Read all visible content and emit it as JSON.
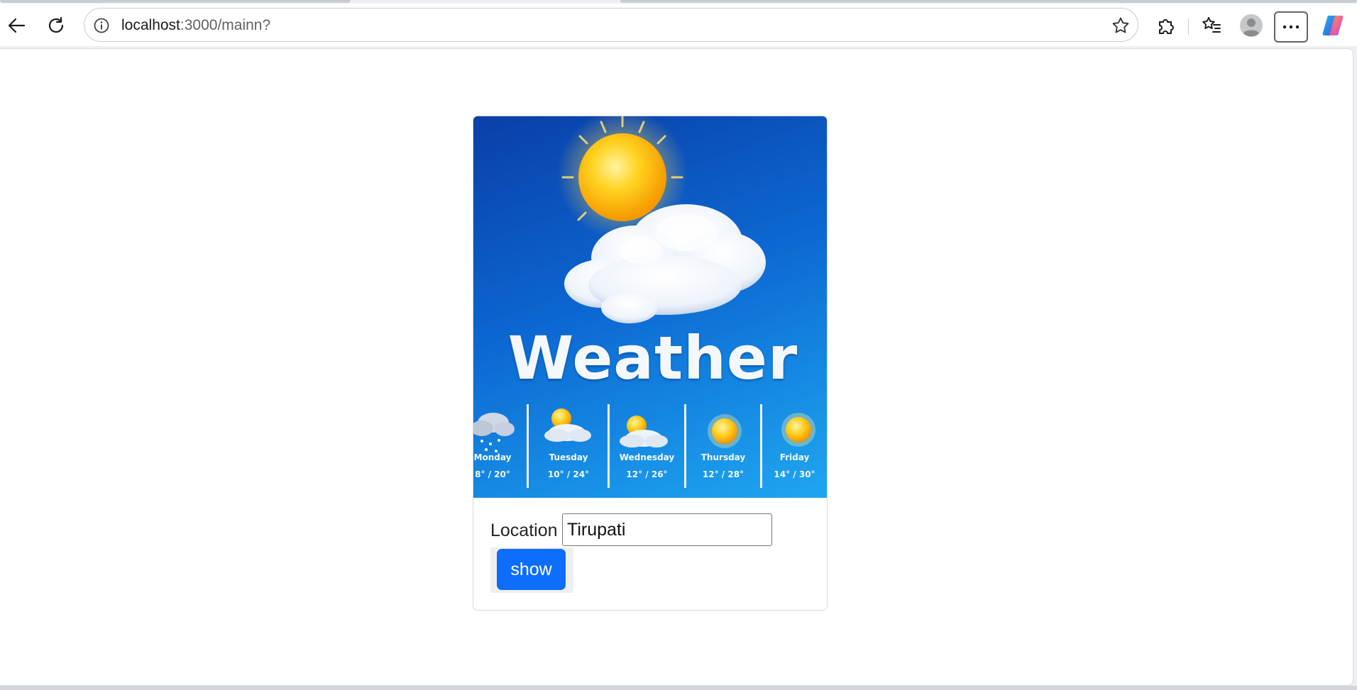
{
  "browser": {
    "url_host": "localhost",
    "url_path": ":3000/mainn?",
    "icons": {
      "back": "back-arrow-icon",
      "reload": "reload-icon",
      "info": "info-icon",
      "favorite": "star-icon",
      "extensions": "puzzle-icon",
      "favorites": "favorites-list-icon",
      "profile": "profile-avatar-icon",
      "more": "ellipsis-icon",
      "copilot": "copilot-icon"
    }
  },
  "card": {
    "banner_title": "Weather",
    "forecast": [
      {
        "day": "Monday",
        "temp": "8° / 20°",
        "icon": "snow-cloud-icon"
      },
      {
        "day": "Tuesday",
        "temp": "10° / 24°",
        "icon": "sun-cloud-icon"
      },
      {
        "day": "Wednesday",
        "temp": "12° / 26°",
        "icon": "sun-cloud-icon"
      },
      {
        "day": "Thursday",
        "temp": "12° / 28°",
        "icon": "sun-icon"
      },
      {
        "day": "Friday",
        "temp": "14° / 30°",
        "icon": "sun-icon"
      }
    ],
    "location_label": "Location",
    "location_value": "Tirupati",
    "submit_label": "show"
  },
  "colors": {
    "primary_button": "#0d6efd",
    "banner_sky_top": "#0a3fa8",
    "banner_sky_bottom": "#1fa6ef",
    "sun": "#ffc21a"
  }
}
